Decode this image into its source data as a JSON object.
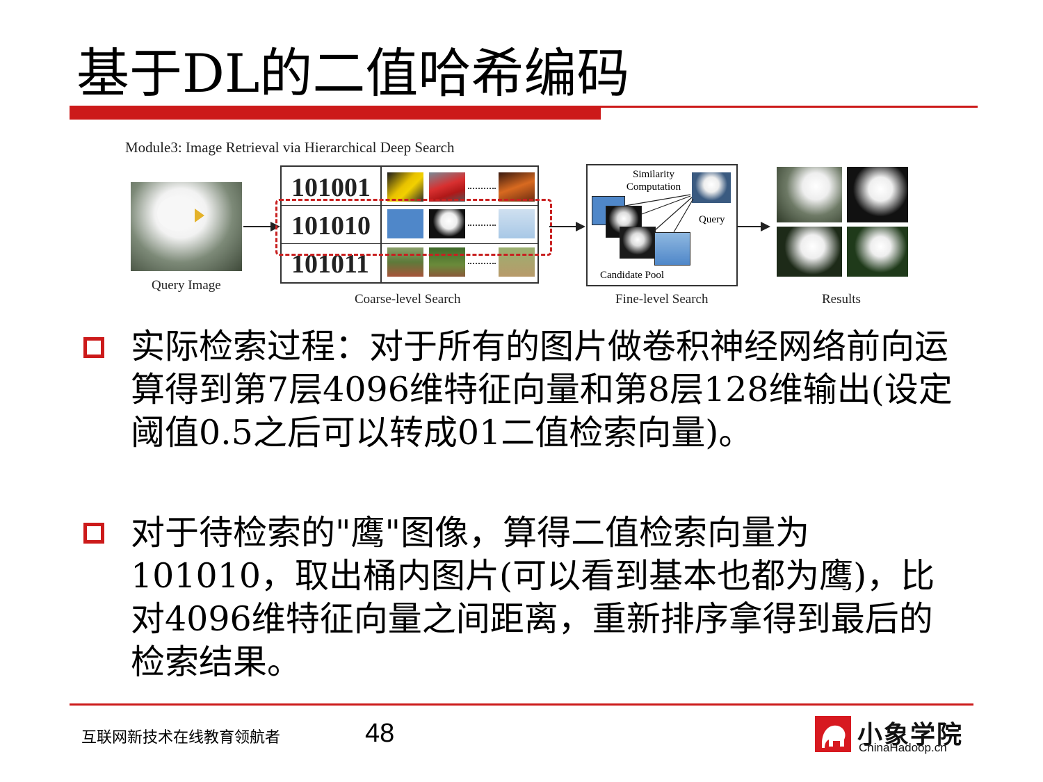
{
  "slide": {
    "title": "基于DL的二值哈希编码"
  },
  "figure": {
    "heading": "Module3: Image Retrieval via Hierarchical Deep Search",
    "query_caption": "Query Image",
    "codes": [
      "101001",
      "101010",
      "101011"
    ],
    "coarse_caption": "Coarse-level Search",
    "similarity_label": "Similarity\nComputation",
    "query_label": "Query",
    "candidate_label": "Candidate Pool",
    "fine_caption": "Fine-level Search",
    "results_caption": "Results",
    "colors": {
      "highlight_dash": "#c82020"
    }
  },
  "bullets": [
    {
      "text": "实际检索过程：对于所有的图片做卷积神经网络前向运算得到第7层4096维特征向量和第8层128维输出(设定阈值0.5之后可以转成01二值检索向量)。"
    },
    {
      "text": "对于待检索的\"鹰\"图像，算得二值检索向量为101010，取出桶内图片(可以看到基本也都为鹰)，比对4096维特征向量之间距离，重新排序拿得到最后的检索结果。"
    }
  ],
  "footer": {
    "slogan": "互联网新技术在线教育领航者",
    "page_number": "48",
    "logo_cn": "小象学院",
    "logo_en": "ChinaHadoop.cn"
  },
  "theme": {
    "accent": "#cc1a1a"
  }
}
